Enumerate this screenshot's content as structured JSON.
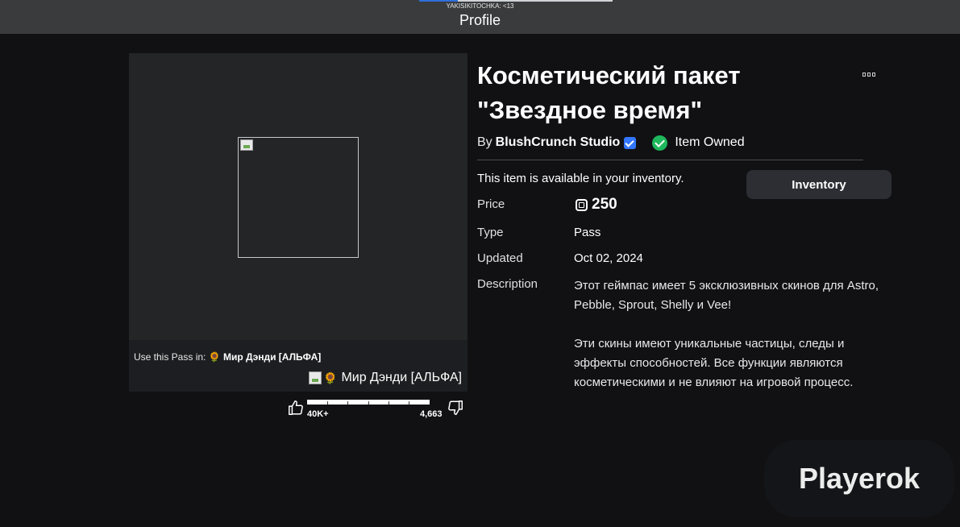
{
  "topbar": {
    "username": "YAKISIKITOCHKA: <13",
    "title": "Profile",
    "progress_fraction": 0.2
  },
  "thumbnail": {
    "use_pass_label": "Use this Pass in:",
    "game_name": "Мир Дэнди [АЛЬФА]",
    "game_icon": "sunflower-icon"
  },
  "votes": {
    "up_count": "40K+",
    "down_count": "4,663",
    "up_icon": "thumbs-up-icon",
    "down_icon": "thumbs-down-icon"
  },
  "item": {
    "title_line1": "Косметический пакет",
    "title_line2": "\"Звездное время\"",
    "by_label": "By",
    "creator": "BlushCrunch Studio",
    "owned_label": "Item Owned",
    "availability": "This item is available in your inventory.",
    "inventory_button": "Inventory",
    "price_label": "Price",
    "price_value": "250",
    "type_label": "Type",
    "type_value": "Pass",
    "updated_label": "Updated",
    "updated_value": "Oct 02, 2024",
    "description_label": "Description",
    "description_p1": "Этот геймпас имеет 5 эксклюзивных скинов для Astro, Pebble, Sprout, Shelly и Vee!",
    "description_p2": "Эти скины имеют уникальные частицы, следы и эффекты способностей. Все функции являются косметическими и не влияют на игровой процесс."
  },
  "watermark": {
    "text": "Playerok"
  },
  "colors": {
    "background": "#111114",
    "topbar": "#393b3d",
    "panel": "#232527",
    "button": "#2c2e33",
    "verified": "#3377ff",
    "owned": "#1fb85c"
  }
}
